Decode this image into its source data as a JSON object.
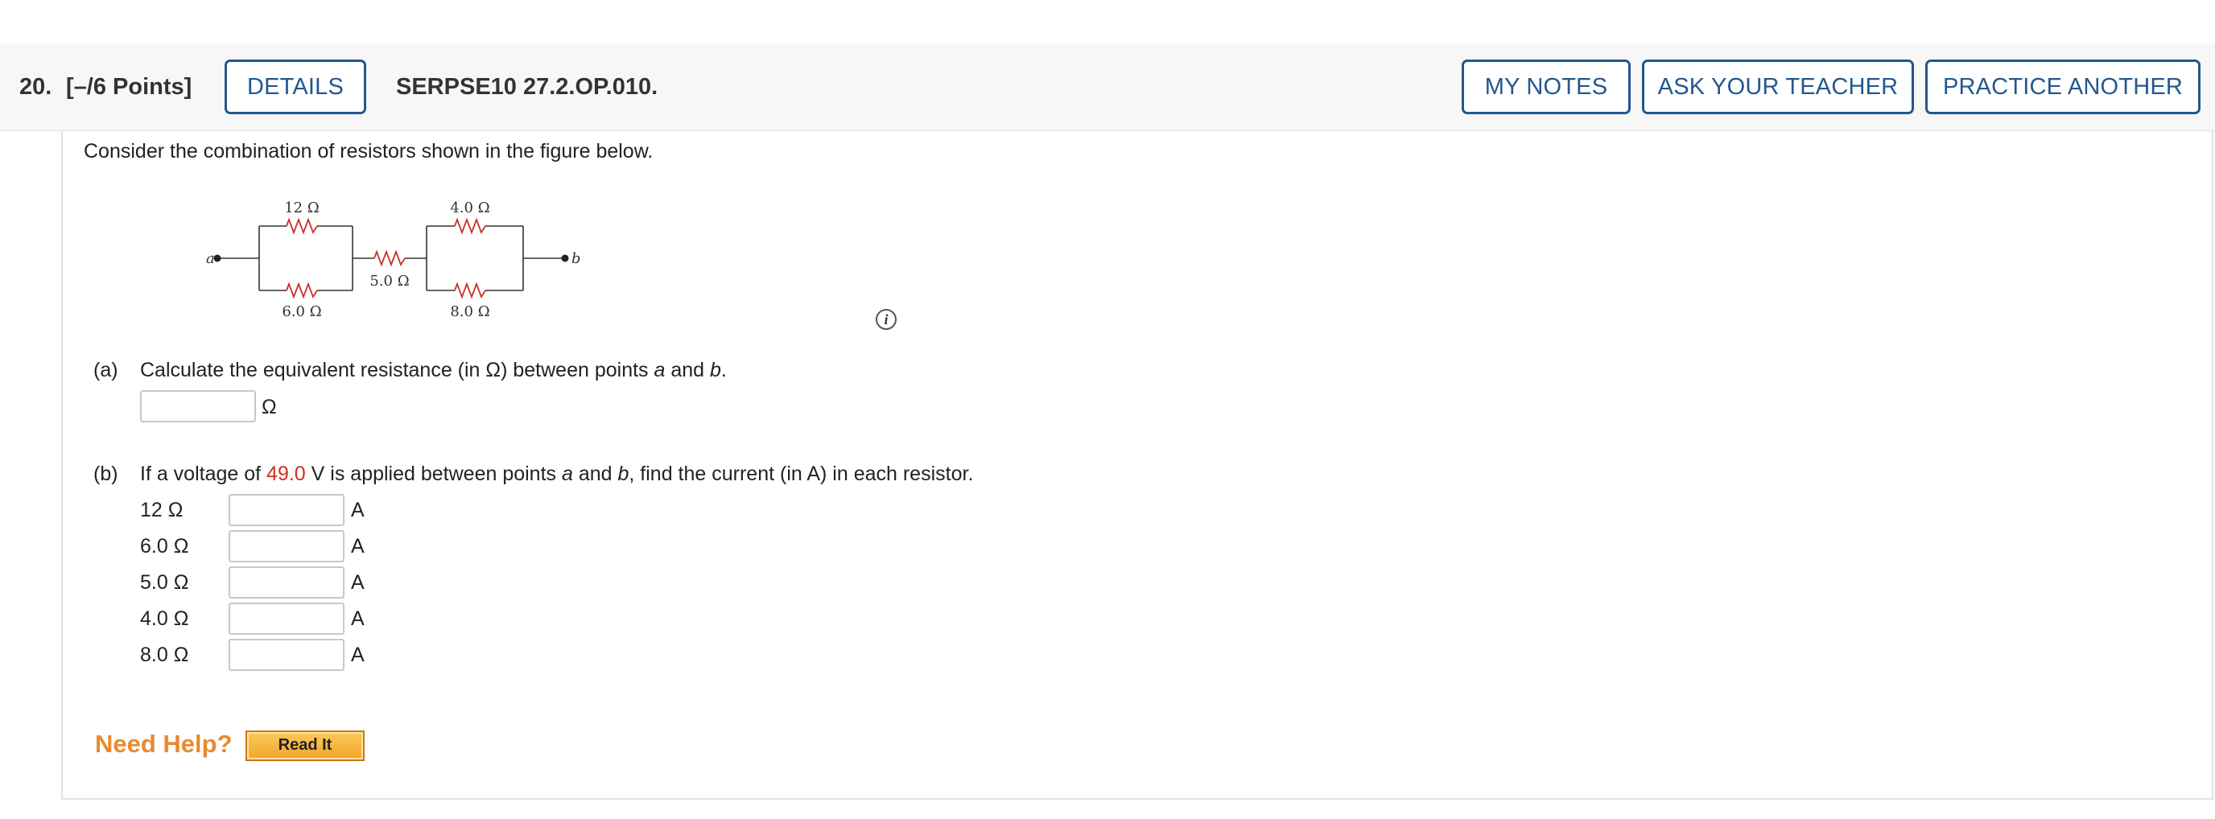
{
  "header": {
    "question_number": "20.",
    "points": "[–/6 Points]",
    "details_label": "DETAILS",
    "question_code": "SERPSE10 27.2.OP.010.",
    "my_notes_label": "MY NOTES",
    "ask_teacher_label": "ASK YOUR TEACHER",
    "practice_label": "PRACTICE ANOTHER"
  },
  "problem": {
    "intro": "Consider the combination of resistors shown in the figure below."
  },
  "figure": {
    "point_a": "a",
    "point_b": "b",
    "r_top_left": "12 Ω",
    "r_bottom_left": "6.0 Ω",
    "r_middle": "5.0 Ω",
    "r_top_right": "4.0 Ω",
    "r_bottom_right": "8.0 Ω"
  },
  "part_a": {
    "label": "(a)",
    "text_before": "Calculate the equivalent resistance (in Ω) between points ",
    "var_a": "a",
    "text_mid": " and ",
    "var_b": "b",
    "text_end": ".",
    "input_value": "",
    "unit": "Ω"
  },
  "part_b": {
    "label": "(b)",
    "text_before": "If a voltage of ",
    "voltage": "49.0",
    "text_after_voltage": " V is applied between points ",
    "var_a": "a",
    "text_mid": " and ",
    "var_b": "b",
    "text_end": ", find the current (in A) in each resistor.",
    "rows": [
      {
        "resistor": "12 Ω",
        "value": "",
        "unit": "A"
      },
      {
        "resistor": "6.0 Ω",
        "value": "",
        "unit": "A"
      },
      {
        "resistor": "5.0 Ω",
        "value": "",
        "unit": "A"
      },
      {
        "resistor": "4.0 Ω",
        "value": "",
        "unit": "A"
      },
      {
        "resistor": "8.0 Ω",
        "value": "",
        "unit": "A"
      }
    ]
  },
  "help": {
    "need_help": "Need Help?",
    "read_it": "Read It"
  },
  "info_icon": "info-icon",
  "colors": {
    "accent_blue": "#23578f",
    "highlight_red": "#d32c1f",
    "help_orange": "#e98a2e",
    "resistor_red": "#c8342a"
  }
}
